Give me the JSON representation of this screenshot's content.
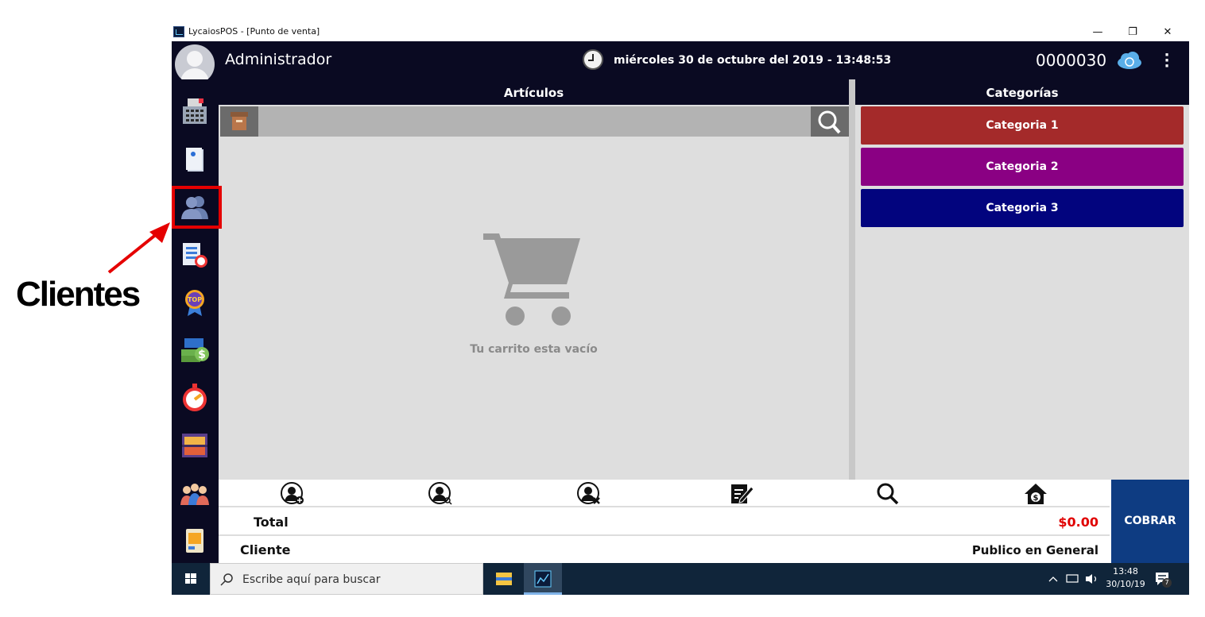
{
  "annotation": {
    "label": "Clientes"
  },
  "window": {
    "title": "LycaiosPOS - [Punto de venta]",
    "controls": {
      "minimize": "—",
      "restore": "❐",
      "close": "✕"
    }
  },
  "header": {
    "user": "Administrador",
    "datetime": "miércoles 30 de octubre del 2019 - 13:48:53",
    "folio": "0000030"
  },
  "sidebar": {
    "items": [
      {
        "name": "punto-de-venta",
        "icon": "register-icon"
      },
      {
        "name": "notas",
        "icon": "notebook-icon"
      },
      {
        "name": "clientes",
        "icon": "users-icon",
        "highlighted": true
      },
      {
        "name": "reportes",
        "icon": "report-clock-icon"
      },
      {
        "name": "top",
        "icon": "top-badge-icon"
      },
      {
        "name": "dinero",
        "icon": "money-icon"
      },
      {
        "name": "tiempo",
        "icon": "stopwatch-icon"
      },
      {
        "name": "inventario",
        "icon": "shelf-icon"
      },
      {
        "name": "usuarios",
        "icon": "people-icon"
      },
      {
        "name": "configuracion",
        "icon": "device-icon"
      }
    ]
  },
  "articles": {
    "title": "Artículos",
    "search_placeholder": "",
    "empty_message": "Tu carrito esta vacío"
  },
  "categories": {
    "title": "Categorías",
    "items": [
      {
        "label": "Categoria 1",
        "color": "#a42a2a"
      },
      {
        "label": "Categoria 2",
        "color": "#8a0083"
      },
      {
        "label": "Categoria 3",
        "color": "#02047e"
      }
    ]
  },
  "actions": [
    {
      "name": "add-client",
      "icon": "user-add-icon"
    },
    {
      "name": "search-client",
      "icon": "user-search-icon"
    },
    {
      "name": "remove-client",
      "icon": "user-remove-icon"
    },
    {
      "name": "edit-note",
      "icon": "edit-note-icon"
    },
    {
      "name": "search",
      "icon": "search-icon"
    },
    {
      "name": "home-price",
      "icon": "house-dollar-icon"
    }
  ],
  "totals": {
    "total_label": "Total",
    "total_value": "$0.00",
    "total_color": "#e00000",
    "client_label": "Cliente",
    "client_value": "Publico en General"
  },
  "cobrar_label": "COBRAR",
  "taskbar": {
    "search_placeholder": "Escribe aquí para buscar",
    "time": "13:48",
    "date": "30/10/19",
    "notifications": "7"
  },
  "colors": {
    "dark": "#0a0a22",
    "panel": "#dedede",
    "cobrar": "#0e3c82",
    "highlight": "#e50000"
  }
}
